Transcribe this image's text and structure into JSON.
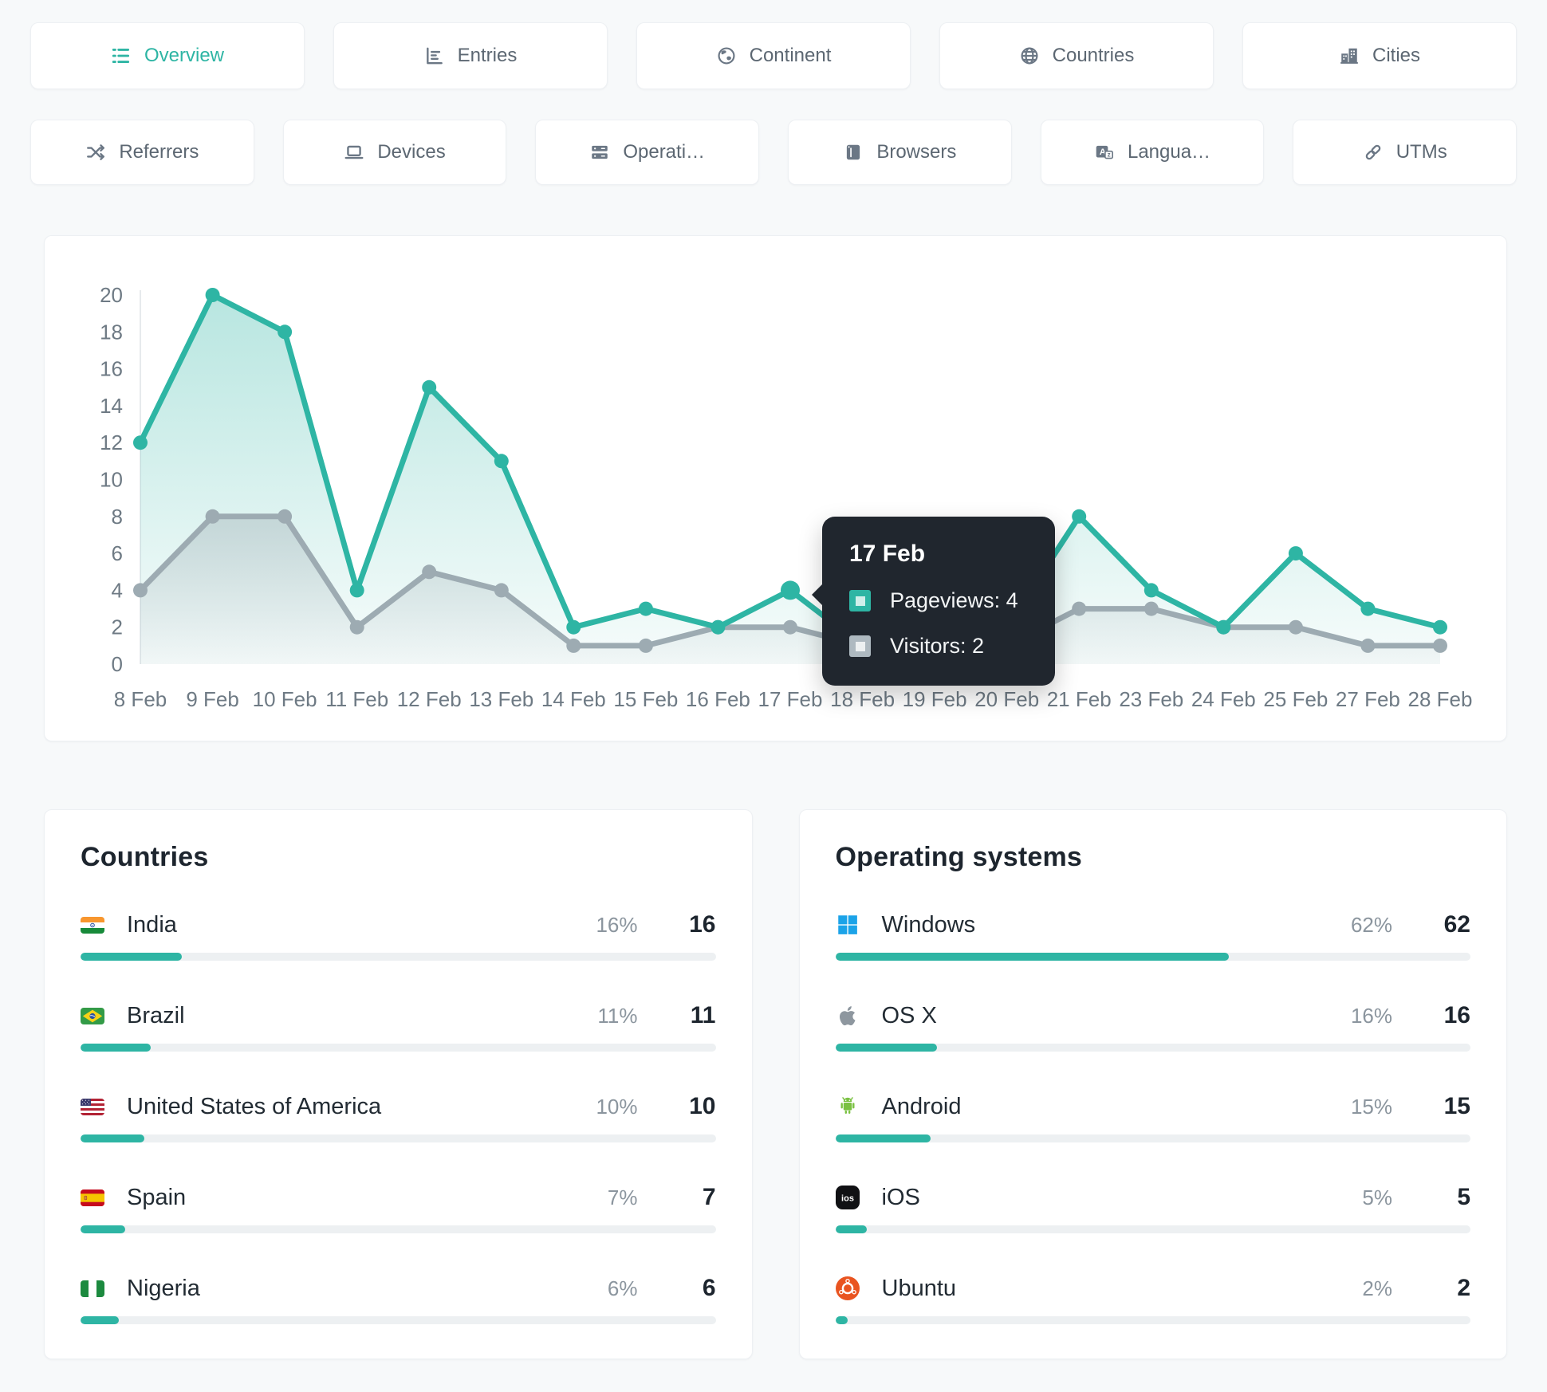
{
  "colors": {
    "accent": "#2eb5a4",
    "gray_series": "#9dabb2",
    "tooltip_bg": "#20262e",
    "bar_track": "#edf0f2",
    "axis_text": "#6e7a84",
    "windows_blue": "#1ba3e8",
    "android_green": "#7ac142",
    "ubuntu_orange": "#e95420"
  },
  "tabs": {
    "row1": [
      {
        "label": "Overview",
        "icon": "list-icon",
        "active": true
      },
      {
        "label": "Entries",
        "icon": "bar-chart-icon",
        "active": false
      },
      {
        "label": "Continent",
        "icon": "continent-icon",
        "active": false
      },
      {
        "label": "Countries",
        "icon": "globe-icon",
        "active": false
      },
      {
        "label": "Cities",
        "icon": "buildings-icon",
        "active": false
      }
    ],
    "row2": [
      {
        "label": "Referrers",
        "icon": "shuffle-icon",
        "active": false
      },
      {
        "label": "Devices",
        "icon": "laptop-icon",
        "active": false
      },
      {
        "label": "Operati…",
        "icon": "servers-icon",
        "active": false
      },
      {
        "label": "Browsers",
        "icon": "browser-icon",
        "active": false
      },
      {
        "label": "Langua…",
        "icon": "language-icon",
        "active": false
      },
      {
        "label": "UTMs",
        "icon": "link-icon",
        "active": false
      }
    ]
  },
  "chart_data": {
    "type": "line",
    "x": [
      "8 Feb",
      "9 Feb",
      "10 Feb",
      "11 Feb",
      "12 Feb",
      "13 Feb",
      "14 Feb",
      "15 Feb",
      "16 Feb",
      "17 Feb",
      "18 Feb",
      "19 Feb",
      "20 Feb",
      "21 Feb",
      "23 Feb",
      "24 Feb",
      "25 Feb",
      "27 Feb",
      "28 Feb"
    ],
    "series": [
      {
        "name": "Pageviews",
        "color": "#2eb5a4",
        "values": [
          12,
          20,
          18,
          4,
          15,
          11,
          2,
          3,
          2,
          4,
          1,
          1,
          2,
          8,
          4,
          2,
          6,
          3,
          2
        ]
      },
      {
        "name": "Visitors",
        "color": "#9dabb2",
        "values": [
          4,
          8,
          8,
          2,
          5,
          4,
          1,
          1,
          2,
          2,
          1,
          1,
          1,
          3,
          3,
          2,
          2,
          1,
          1
        ]
      }
    ],
    "ylim": [
      0,
      20
    ],
    "yticks": [
      0,
      2,
      4,
      6,
      8,
      10,
      12,
      14,
      16,
      18,
      20
    ],
    "grid": false,
    "legend": "none",
    "tooltip": {
      "date": "17 Feb",
      "index": 9,
      "rows": [
        {
          "series": "Pageviews",
          "value": 4
        },
        {
          "series": "Visitors",
          "value": 2
        }
      ]
    }
  },
  "panels": {
    "countries": {
      "title": "Countries",
      "rows": [
        {
          "icon": "flag-india",
          "label": "India",
          "pct": 16,
          "pct_label": "16%",
          "value": 16
        },
        {
          "icon": "flag-brazil",
          "label": "Brazil",
          "pct": 11,
          "pct_label": "11%",
          "value": 11
        },
        {
          "icon": "flag-usa",
          "label": "United States of America",
          "pct": 10,
          "pct_label": "10%",
          "value": 10
        },
        {
          "icon": "flag-spain",
          "label": "Spain",
          "pct": 7,
          "pct_label": "7%",
          "value": 7
        },
        {
          "icon": "flag-nigeria",
          "label": "Nigeria",
          "pct": 6,
          "pct_label": "6%",
          "value": 6
        }
      ]
    },
    "operating_systems": {
      "title": "Operating systems",
      "rows": [
        {
          "icon": "windows-icon",
          "label": "Windows",
          "pct": 62,
          "pct_label": "62%",
          "value": 62
        },
        {
          "icon": "apple-icon",
          "label": "OS X",
          "pct": 16,
          "pct_label": "16%",
          "value": 16
        },
        {
          "icon": "android-icon",
          "label": "Android",
          "pct": 15,
          "pct_label": "15%",
          "value": 15
        },
        {
          "icon": "ios-icon",
          "label": "iOS",
          "pct": 5,
          "pct_label": "5%",
          "value": 5
        },
        {
          "icon": "ubuntu-icon",
          "label": "Ubuntu",
          "pct": 2,
          "pct_label": "2%",
          "value": 2
        }
      ]
    }
  }
}
